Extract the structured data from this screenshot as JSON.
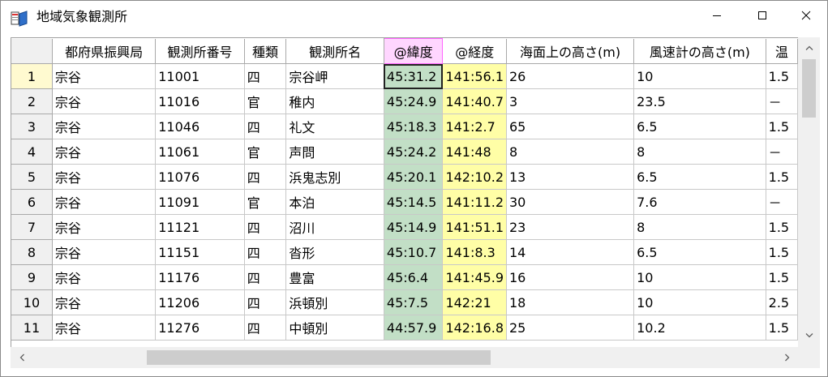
{
  "window": {
    "title": "地域気象観測所",
    "icons": {
      "app": "book-icon",
      "minimize": "minimize-icon",
      "maximize": "maximize-icon",
      "close": "close-icon"
    }
  },
  "table": {
    "columns": [
      "都府県振興局",
      "観測所番号",
      "種類",
      "観測所名",
      "@緯度",
      "@経度",
      "海面上の高さ(m)",
      "風速計の高さ(m)",
      "温"
    ],
    "rows": [
      {
        "num": "1",
        "cells": [
          "宗谷",
          "11001",
          "四",
          "宗谷岬",
          "45:31.2",
          "141:56.1",
          "26",
          "10",
          "1.5"
        ]
      },
      {
        "num": "2",
        "cells": [
          "宗谷",
          "11016",
          "官",
          "稚内",
          "45:24.9",
          "141:40.7",
          "3",
          "23.5",
          "－"
        ]
      },
      {
        "num": "3",
        "cells": [
          "宗谷",
          "11046",
          "四",
          "礼文",
          "45:18.3",
          "141:2.7",
          "65",
          "6.5",
          "1.5"
        ]
      },
      {
        "num": "4",
        "cells": [
          "宗谷",
          "11061",
          "官",
          "声問",
          "45:24.2",
          "141:48",
          "8",
          "8",
          "－"
        ]
      },
      {
        "num": "5",
        "cells": [
          "宗谷",
          "11076",
          "四",
          "浜鬼志別",
          "45:20.1",
          "142:10.2",
          "13",
          "6.5",
          "1.5"
        ]
      },
      {
        "num": "6",
        "cells": [
          "宗谷",
          "11091",
          "官",
          "本泊",
          "45:14.5",
          "141:11.2",
          "30",
          "7.6",
          "－"
        ]
      },
      {
        "num": "7",
        "cells": [
          "宗谷",
          "11121",
          "四",
          "沼川",
          "45:14.9",
          "141:51.1",
          "23",
          "8",
          "1.5"
        ]
      },
      {
        "num": "8",
        "cells": [
          "宗谷",
          "11151",
          "四",
          "沓形",
          "45:10.7",
          "141:8.3",
          "14",
          "6.5",
          "1.5"
        ]
      },
      {
        "num": "9",
        "cells": [
          "宗谷",
          "11176",
          "四",
          "豊富",
          "45:6.4",
          "141:45.9",
          "16",
          "10",
          "1.5"
        ]
      },
      {
        "num": "10",
        "cells": [
          "宗谷",
          "11206",
          "四",
          "浜頓別",
          "45:7.5",
          "142:21",
          "18",
          "10",
          "2.5"
        ]
      },
      {
        "num": "11",
        "cells": [
          "宗谷",
          "11276",
          "四",
          "中頓別",
          "44:57.9",
          "142:16.8",
          "25",
          "10.2",
          "1.5"
        ]
      }
    ]
  },
  "colors": {
    "latitude_column": "#c2dfc6",
    "longitude_column": "#fffea6",
    "selected_header": "#ffd6ff",
    "selected_row_header": "#fffad0"
  },
  "scrollbars": {
    "vertical": "chevron-up-icon / chevron-down-icon",
    "horizontal": "chevron-left-icon / chevron-right-icon"
  }
}
